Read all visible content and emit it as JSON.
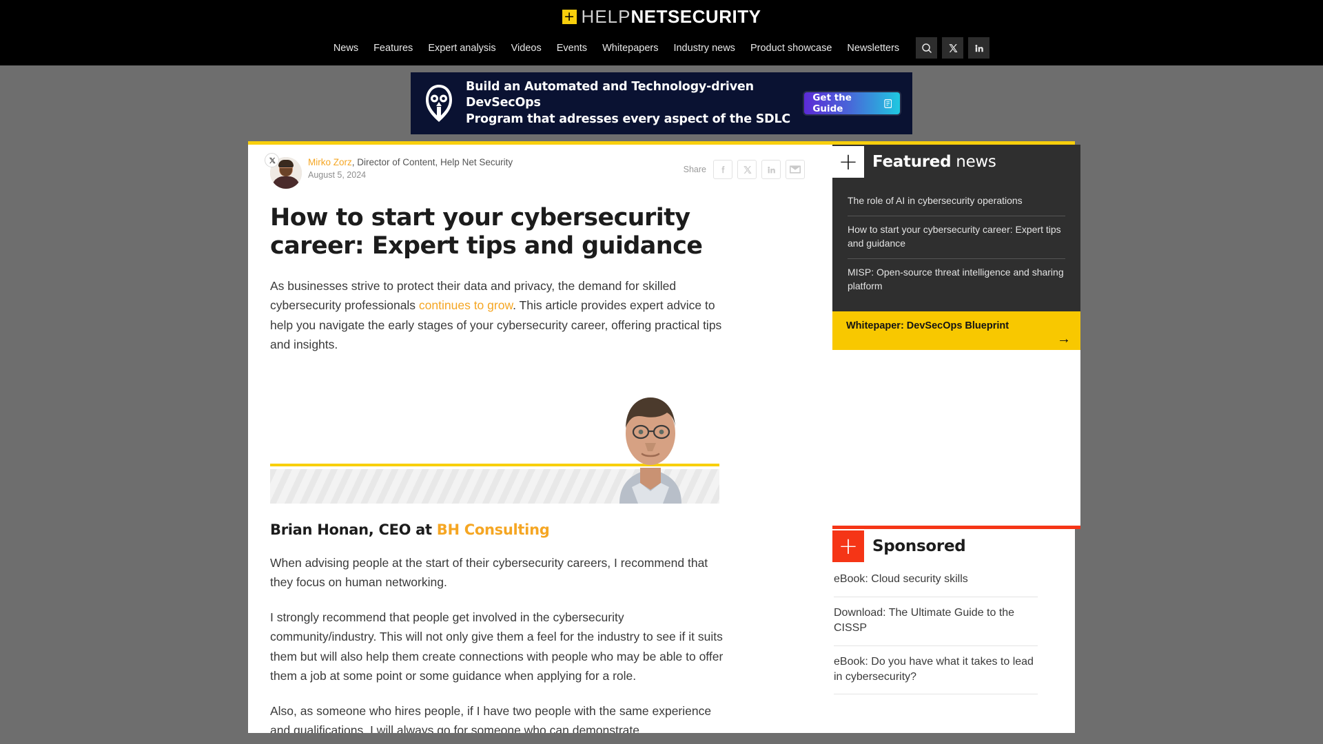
{
  "header": {
    "logo": {
      "plus": "+",
      "help": "HELP",
      "net": "NET",
      "security": "SECURITY"
    },
    "nav": [
      {
        "label": "News"
      },
      {
        "label": "Features"
      },
      {
        "label": "Expert analysis"
      },
      {
        "label": "Videos"
      },
      {
        "label": "Events"
      },
      {
        "label": "Whitepapers"
      },
      {
        "label": "Industry news"
      },
      {
        "label": "Product showcase"
      },
      {
        "label": "Newsletters"
      }
    ],
    "icons": [
      {
        "name": "search-icon"
      },
      {
        "name": "x-twitter-icon"
      },
      {
        "name": "linkedin-icon"
      }
    ]
  },
  "ad_banner": {
    "line1": "Build an Automated and Technology-driven DevSecOps",
    "line2": "Program that adresses every aspect of the SDLC",
    "button_label": "Get the Guide",
    "bg_color": "#0a1232",
    "button_gradient_from": "#5b2bd6",
    "button_gradient_to": "#1fc8e0"
  },
  "article": {
    "author_name": "Mirko Zorz",
    "author_role": ", Director of Content, Help Net Security",
    "date": "August 5, 2024",
    "share_label": "Share",
    "share_buttons": [
      {
        "name": "facebook-share-button"
      },
      {
        "name": "x-share-button"
      },
      {
        "name": "linkedin-share-button"
      },
      {
        "name": "email-share-button"
      }
    ],
    "headline": "How to start your cybersecurity career: Expert tips and guidance",
    "intro_part1": "As businesses strive to protect their data and privacy, the demand for skilled cybersecurity professionals ",
    "intro_link": "continues to grow",
    "intro_part2": ". This article provides expert advice to help you navigate the early stages of your cybersecurity career, offering practical tips and insights.",
    "expert_heading_prefix": "Brian Honan, CEO at ",
    "expert_heading_org": "BH Consulting",
    "paragraph1": "When advising people at the start of their cybersecurity careers, I recommend that they focus on human networking.",
    "paragraph2": "I strongly recommend that people get involved in the cybersecurity community/industry. This will not only give them a feel for the industry to see if it suits them but will also help them create connections with people who may be able to offer them a job at some point or some guidance when applying for a role.",
    "paragraph3": "Also, as someone who hires people, if I have two people with the same experience and qualifications, I will always go for someone who can demonstrate"
  },
  "sidebar": {
    "featured": {
      "plus": "+",
      "title_bold": "Featured",
      "title_normal": " news",
      "items": [
        {
          "label": "The role of AI in cybersecurity operations"
        },
        {
          "label": "How to start your cybersecurity career: Expert tips and guidance"
        },
        {
          "label": "MISP: Open-source threat intelligence and sharing platform"
        }
      ]
    },
    "whitepaper_cta": {
      "label": "Whitepaper: DevSecOps Blueprint",
      "arrow": "→",
      "bg_color": "#f8c800"
    },
    "sponsored": {
      "plus": "+",
      "title": "Sponsored",
      "accent_color": "#f53516",
      "items": [
        {
          "label": "eBook: Cloud security skills"
        },
        {
          "label": "Download: The Ultimate Guide to the CISSP"
        },
        {
          "label": "eBook: Do you have what it takes to lead in cybersecurity?"
        }
      ]
    }
  },
  "theme": {
    "brand_yellow": "#f8cf0c",
    "accent_orange": "#f5a623",
    "accent_red": "#f53516",
    "page_bg": "#6e6e6e",
    "dark_panel": "#2f2f2f"
  }
}
